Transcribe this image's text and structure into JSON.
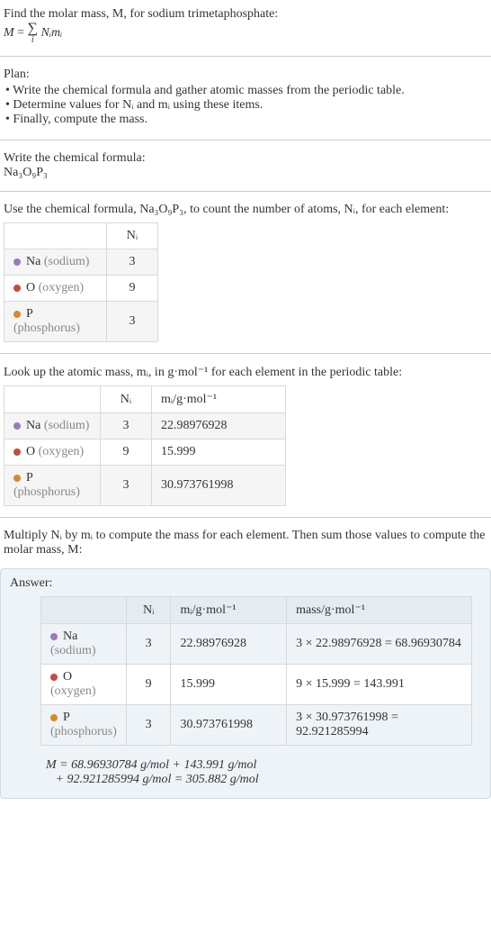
{
  "intro": "Find the molar mass, M, for sodium trimetaphosphate:",
  "formula_line": "M = ∑ Nᵢmᵢ",
  "formula_parts": {
    "M": "M",
    "eq": " = ",
    "Nimi": "Nᵢmᵢ",
    "i": "i"
  },
  "plan_title": "Plan:",
  "plan": [
    "Write the chemical formula and gather atomic masses from the periodic table.",
    "Determine values for Nᵢ and mᵢ using these items.",
    "Finally, compute the mass."
  ],
  "write_formula_label": "Write the chemical formula:",
  "chem_formula": "Na₃O₉P₃",
  "count_intro_a": "Use the chemical formula, ",
  "count_intro_b": ", to count the number of atoms, Nᵢ, for each element:",
  "headers": {
    "Ni": "Nᵢ",
    "mi": "mᵢ/g·mol⁻¹",
    "mass": "mass/g·mol⁻¹"
  },
  "elements": [
    {
      "sym": "Na",
      "name": "(sodium)",
      "dot": "na",
      "N": "3",
      "m": "22.98976928",
      "calc": "3 × 22.98976928 = 68.96930784"
    },
    {
      "sym": "O",
      "name": "(oxygen)",
      "dot": "o",
      "N": "9",
      "m": "15.999",
      "calc": "9 × 15.999 = 143.991"
    },
    {
      "sym": "P",
      "name": "(phosphorus)",
      "dot": "p",
      "N": "3",
      "m": "30.973761998",
      "calc": "3 × 30.973761998 = 92.921285994"
    }
  ],
  "lookup_intro": "Look up the atomic mass, mᵢ, in g·mol⁻¹ for each element in the periodic table:",
  "multiply_intro": "Multiply Nᵢ by mᵢ to compute the mass for each element. Then sum those values to compute the molar mass, M:",
  "answer_label": "Answer:",
  "final_1": "M = 68.96930784 g/mol + 143.991 g/mol",
  "final_2": "+ 92.921285994 g/mol = 305.882 g/mol"
}
